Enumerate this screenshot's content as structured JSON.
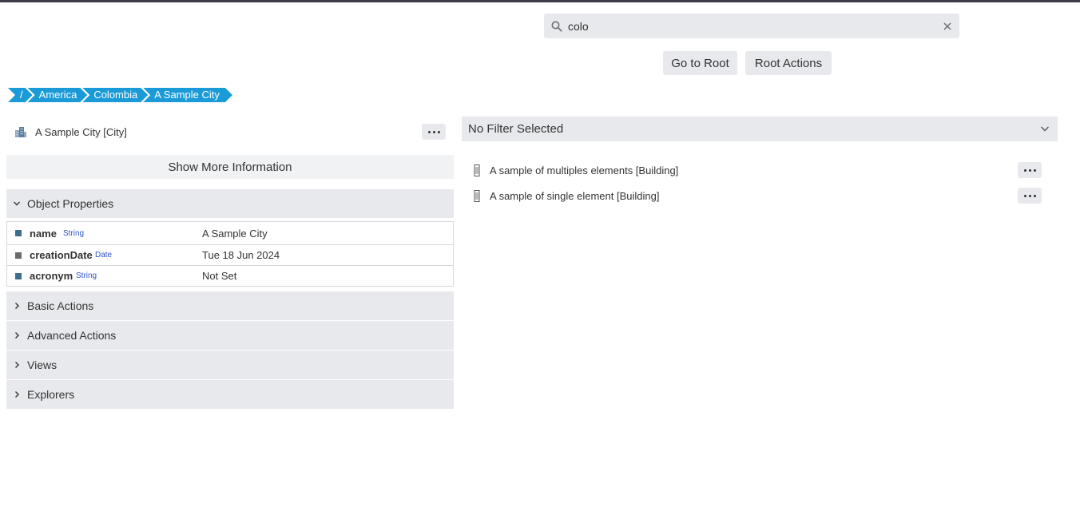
{
  "search": {
    "value": "colo",
    "placeholder": ""
  },
  "top_buttons": {
    "go_to_root": "Go to Root",
    "root_actions": "Root Actions"
  },
  "breadcrumb": [
    "/",
    "America",
    "Colombia",
    "A Sample City"
  ],
  "object": {
    "title": "A Sample City [City]",
    "icon": "city-buildings-icon"
  },
  "show_more_label": "Show More Information",
  "sections": {
    "object_properties": "Object Properties",
    "basic_actions": "Basic Actions",
    "advanced_actions": "Advanced Actions",
    "views": "Views",
    "explorers": "Explorers"
  },
  "properties": [
    {
      "name": "name",
      "type": "String",
      "value": "A Sample City"
    },
    {
      "name": "creationDate",
      "type": "Date",
      "value": "Tue 18 Jun 2024"
    },
    {
      "name": "acronym",
      "type": "String",
      "value": "Not Set"
    }
  ],
  "filter": {
    "label": "No Filter Selected"
  },
  "children": [
    {
      "label": "A sample of multiples elements [Building]",
      "icon": "building-icon"
    },
    {
      "label": "A sample of single element [Building]",
      "icon": "building-icon"
    }
  ],
  "colors": {
    "breadcrumb": "#1a9ad6",
    "panel": "#e8e9ed",
    "type_badge": "#2f55c9"
  }
}
